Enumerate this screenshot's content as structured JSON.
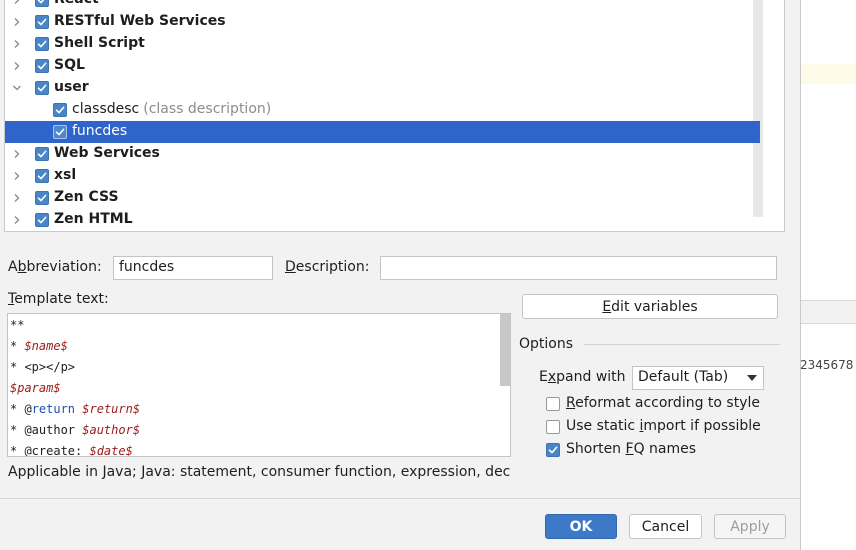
{
  "tree": {
    "items": [
      {
        "label": "React",
        "description": "",
        "indent": 0,
        "expanded": false,
        "selected": false,
        "bold": true
      },
      {
        "label": "RESTful Web Services",
        "description": "",
        "indent": 0,
        "expanded": false,
        "selected": false,
        "bold": true
      },
      {
        "label": "Shell Script",
        "description": "",
        "indent": 0,
        "expanded": false,
        "selected": false,
        "bold": true
      },
      {
        "label": "SQL",
        "description": "",
        "indent": 0,
        "expanded": false,
        "selected": false,
        "bold": true
      },
      {
        "label": "user",
        "description": "",
        "indent": 0,
        "expanded": true,
        "selected": false,
        "bold": true
      },
      {
        "label": "classdesc",
        "description": "(class description)",
        "indent": 1,
        "expanded": false,
        "selected": false,
        "bold": false
      },
      {
        "label": "funcdes",
        "description": "",
        "indent": 1,
        "expanded": false,
        "selected": true,
        "bold": false
      },
      {
        "label": "Web Services",
        "description": "",
        "indent": 0,
        "expanded": false,
        "selected": false,
        "bold": true
      },
      {
        "label": "xsl",
        "description": "",
        "indent": 0,
        "expanded": false,
        "selected": false,
        "bold": true
      },
      {
        "label": "Zen CSS",
        "description": "",
        "indent": 0,
        "expanded": false,
        "selected": false,
        "bold": true
      },
      {
        "label": "Zen HTML",
        "description": "",
        "indent": 0,
        "expanded": false,
        "selected": false,
        "bold": true
      }
    ]
  },
  "form": {
    "abbreviation_label_pre": "A",
    "abbreviation_label_u": "b",
    "abbreviation_label_post": "breviation:",
    "abbreviation_value": "funcdes",
    "description_label_u": "D",
    "description_label_post": "escription:",
    "description_value": "",
    "template_label_u": "T",
    "template_label_post": "emplate text:",
    "edit_variables_u": "E",
    "edit_variables_post": "dit variables"
  },
  "template_lines": [
    [
      {
        "t": "**",
        "c": "plain"
      }
    ],
    [
      {
        "t": "* ",
        "c": "plain"
      },
      {
        "t": "$name$",
        "c": "var"
      }
    ],
    [
      {
        "t": "* <p></p>",
        "c": "plain"
      }
    ],
    [
      {
        "t": "$param$",
        "c": "var"
      }
    ],
    [
      {
        "t": "* @",
        "c": "plain"
      },
      {
        "t": "return",
        "c": "kw"
      },
      {
        "t": " ",
        "c": "plain"
      },
      {
        "t": "$return$",
        "c": "var"
      }
    ],
    [
      {
        "t": "* @author ",
        "c": "plain"
      },
      {
        "t": "$author$",
        "c": "var"
      }
    ],
    [
      {
        "t": "* @create: ",
        "c": "plain"
      },
      {
        "t": "$date$",
        "c": "var"
      }
    ]
  ],
  "applicable_text": "Applicable in Java; Java: statement, consumer function, expression, decla",
  "options": {
    "title": "Options",
    "expand_label_pre": "E",
    "expand_label_u": "x",
    "expand_label_post": "pand with",
    "expand_value": "Default (Tab)",
    "reformat": {
      "pre": "",
      "u": "R",
      "post": "eformat according to style",
      "checked": false
    },
    "static_import": {
      "pre": "Use static ",
      "u": "i",
      "post": "mport if possible",
      "checked": false
    },
    "shorten_fq": {
      "pre": "Shorten ",
      "u": "F",
      "post": "Q names",
      "checked": true
    }
  },
  "buttons": {
    "ok": "OK",
    "cancel": "Cancel",
    "apply": "Apply"
  },
  "background": {
    "numbers": "2345678"
  },
  "colors": {
    "selection": "#2f65ca",
    "checkbox": "#4a86c7",
    "ok_button": "#3d79c7",
    "variable": "#9b1b1b",
    "keyword": "#1d4fb5"
  }
}
